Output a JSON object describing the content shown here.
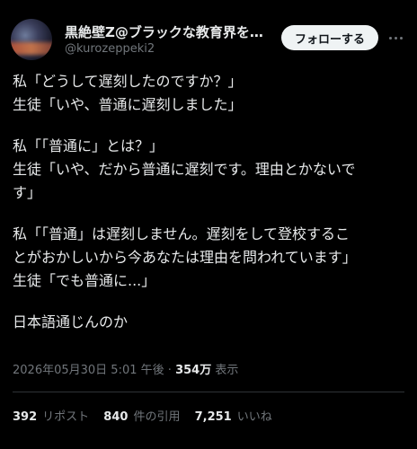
{
  "author": {
    "name": "黒絶壁Z@ブラックな教育界を…",
    "handle": "@kurozeppeki2",
    "follow_label": "フォローする",
    "more_icon": "more-horizontal-icon"
  },
  "tweet": {
    "lines": [
      "私「どうして遅刻したのですか？」",
      "生徒「いや、普通に遅刻しました」",
      "",
      "私「「普通に」とは？」",
      "生徒「いや、だから普通に遅刻です。理由とかないで",
      "す」",
      "",
      "私「「普通」は遅刻しません。遅刻をして登校するこ",
      "とがおかしいから今あなたは理由を問われています」",
      "生徒「でも普通に...」",
      "",
      "日本語通じんのか"
    ]
  },
  "meta": {
    "timestamp": "2026年05月30日 5:01 午後",
    "separator": "·",
    "views": "354万",
    "views_label": "表示"
  },
  "stats": {
    "reposts": "392",
    "reposts_label": "リポスト",
    "quotes": "840",
    "quotes_label": "件の引用",
    "likes": "7,251",
    "likes_label": "いいね"
  },
  "colors": {
    "background": "#000000",
    "text": "#e7e9ea",
    "secondary": "#71767b",
    "button_bg": "#eff3f4",
    "divider": "#2f3336"
  }
}
